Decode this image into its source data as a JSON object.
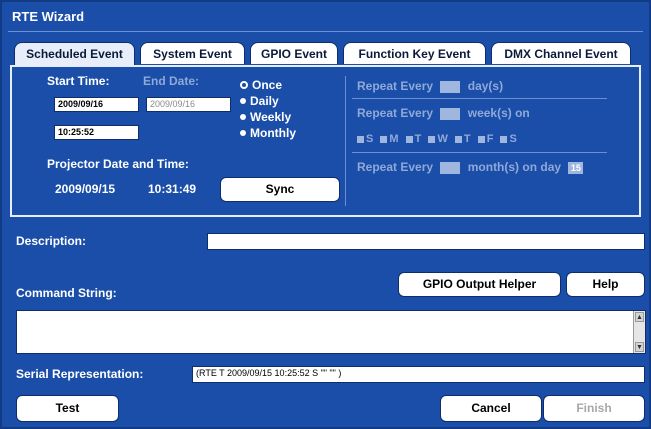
{
  "window": {
    "title": "RTE Wizard"
  },
  "tabs": [
    {
      "label": "Scheduled Event",
      "active": true
    },
    {
      "label": "System Event"
    },
    {
      "label": "GPIO Event"
    },
    {
      "label": "Function Key Event"
    },
    {
      "label": "DMX Channel Event"
    }
  ],
  "schedule": {
    "start_time_label": "Start Time:",
    "end_date_label": "End Date:",
    "start_date_value": "2009/09/16",
    "end_date_value": "2009/09/16",
    "start_time_value": "10:25:52",
    "recurrence": [
      {
        "label": "Once",
        "selected": true
      },
      {
        "label": "Daily"
      },
      {
        "label": "Weekly"
      },
      {
        "label": "Monthly"
      }
    ],
    "projector_label": "Projector Date and Time:",
    "projector_date": "2009/09/15",
    "projector_time": "10:31:49",
    "sync_label": "Sync",
    "repeat_days_prefix": "Repeat Every",
    "repeat_days_suffix": "day(s)",
    "repeat_weeks_prefix": "Repeat Every",
    "repeat_weeks_suffix": "week(s) on",
    "weekdays": [
      "S",
      "M",
      "T",
      "W",
      "T",
      "F",
      "S"
    ],
    "repeat_months_prefix": "Repeat Every",
    "repeat_months_suffix": "month(s) on day",
    "repeat_months_day": "15"
  },
  "description": {
    "label": "Description:",
    "value": ""
  },
  "command": {
    "label": "Command String:",
    "gpio_helper_label": "GPIO Output Helper",
    "help_label": "Help",
    "value": ""
  },
  "serial": {
    "label": "Serial Representation:",
    "value": "(RTE T 2009/09/15 10:25:52 S \"\" \"\" )"
  },
  "footer": {
    "test_label": "Test",
    "cancel_label": "Cancel",
    "finish_label": "Finish"
  },
  "colors": {
    "background": "#1a4ea8",
    "text": "#ffffff",
    "disabled_text": "#8fa9d9"
  }
}
